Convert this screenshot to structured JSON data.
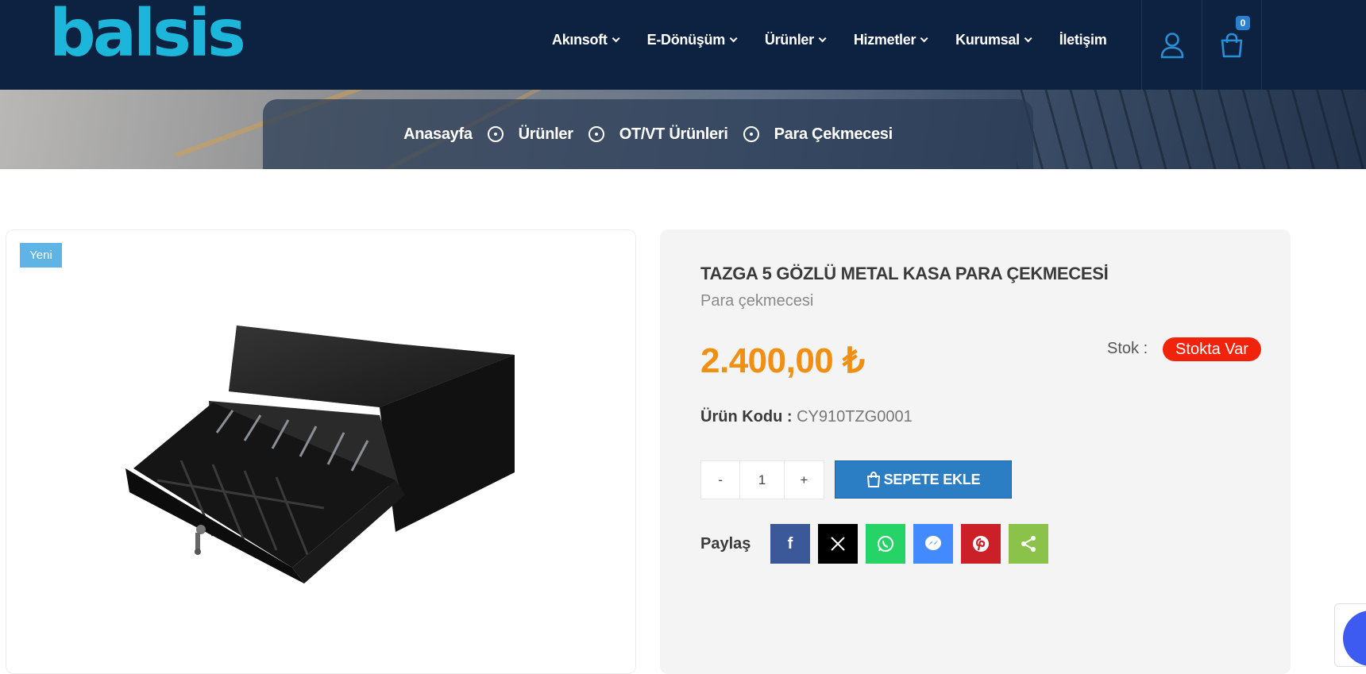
{
  "brand": {
    "logo_text": "balsis",
    "accent": "#1bb6d9",
    "header_bg": "#0d2240"
  },
  "nav": {
    "items": [
      {
        "label": "Akınsoft",
        "dropdown": true
      },
      {
        "label": "E-Dönüşüm",
        "dropdown": true
      },
      {
        "label": "Ürünler",
        "dropdown": true
      },
      {
        "label": "Hizmetler",
        "dropdown": true
      },
      {
        "label": "Kurumsal",
        "dropdown": true
      },
      {
        "label": "İletişim",
        "dropdown": false
      }
    ],
    "user_icon": "user-icon",
    "cart_icon": "shopping-bag-icon",
    "cart_count": "0"
  },
  "breadcrumb": [
    "Anasayfa",
    "Ürünler",
    "OT/VT Ürünleri",
    "Para Çekmecesi"
  ],
  "product": {
    "badge": "Yeni",
    "image_alt": "cash-drawer-image",
    "title": "TAZGA 5 GÖZLÜ METAL KASA PARA ÇEKMECESİ",
    "subtitle": "Para çekmecesi",
    "price": "2.400,00 ₺",
    "price_color": "#f18f13",
    "stock_label": "Stok :",
    "stock_status": "Stokta Var",
    "code_label": "Ürün Kodu :",
    "code_value": "CY910TZG0001",
    "qty_minus": "-",
    "qty_value": "1",
    "qty_plus": "+",
    "add_to_cart": "SEPETE EKLE",
    "share_label": "Paylaş",
    "share_buttons": [
      {
        "name": "facebook",
        "icon": "facebook-icon",
        "color": "#3b5998"
      },
      {
        "name": "x",
        "icon": "x-icon",
        "color": "#000000"
      },
      {
        "name": "whatsapp",
        "icon": "whatsapp-icon",
        "color": "#25d366"
      },
      {
        "name": "messenger",
        "icon": "messenger-icon",
        "color": "#448aff"
      },
      {
        "name": "pinterest",
        "icon": "pinterest-icon",
        "color": "#cb2027"
      },
      {
        "name": "share",
        "icon": "share-icon",
        "color": "#8bc34a"
      }
    ]
  }
}
